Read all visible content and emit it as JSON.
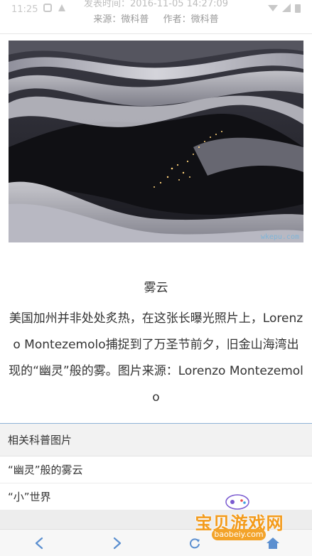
{
  "status_bar": {
    "time": "11:25",
    "left_icons": [
      "notification-icon",
      "alert-icon"
    ],
    "right_icons": [
      "wifi-icon",
      "signal-icon",
      "battery-icon"
    ]
  },
  "meta": {
    "publish_time": "发表时间：2016-11-05 14:27:09",
    "source": "来源：微科普",
    "author": "作者：微科普"
  },
  "photo": {
    "watermark": "wkepu.com"
  },
  "caption": {
    "title": "雾云",
    "body": "美国加州并非处处炙热，在这张长曝光照片上，Lorenzo Montezemolo捕捉到了万圣节前夕，旧金山海湾出现的“幽灵”般的雾。图片来源：Lorenzo Montezemolo"
  },
  "related": {
    "header": "相关科普图片",
    "items": [
      "“幽灵”般的雾云",
      "“小”世界"
    ]
  },
  "bottom_nav": {
    "buttons": [
      "back-icon",
      "forward-icon",
      "refresh-icon",
      "home-icon"
    ]
  },
  "logo": {
    "text": "宝贝游戏网",
    "url": "baobeiy.com"
  },
  "colors": {
    "accent": "#5b8fd0",
    "logo_orange": "#f39b1c"
  }
}
